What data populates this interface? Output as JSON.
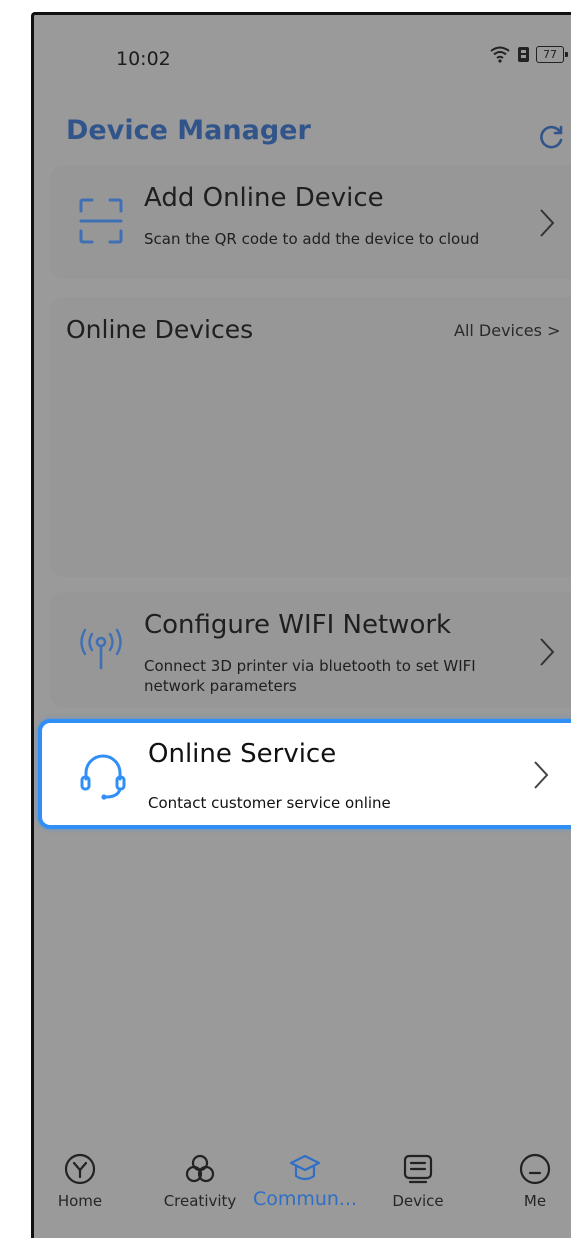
{
  "status_bar": {
    "time": "10:02",
    "battery": "77",
    "icons": [
      "wifi-icon",
      "battery-saver-icon",
      "battery-icon"
    ]
  },
  "header": {
    "title": "Device Manager",
    "refresh_icon": "refresh-icon"
  },
  "add_device": {
    "icon": "scan-icon",
    "title": "Add Online Device",
    "subtitle": "Scan the QR code to add the device to cloud"
  },
  "online_devices": {
    "title": "Online Devices",
    "link": "All Devices >"
  },
  "configure_wifi": {
    "icon": "antenna-icon",
    "title": "Configure WIFI Network",
    "subtitle": "Connect 3D printer via bluetooth to set WIFI network parameters"
  },
  "online_service": {
    "icon": "headset-icon",
    "title": "Online Service",
    "subtitle": "Contact customer service online"
  },
  "tabbar": {
    "items": [
      {
        "label": "Home",
        "icon": "home-icon",
        "active": false
      },
      {
        "label": "Creativity",
        "icon": "creativity-icon",
        "active": false
      },
      {
        "label": "Commun...",
        "icon": "community-icon",
        "active": true
      },
      {
        "label": "Device",
        "icon": "device-icon",
        "active": false
      },
      {
        "label": "Me",
        "icon": "me-icon",
        "active": false
      }
    ]
  },
  "colors": {
    "accent": "#2f8ff7",
    "title_blue": "#31558a",
    "overlay_gray": "#9a9a9a"
  }
}
